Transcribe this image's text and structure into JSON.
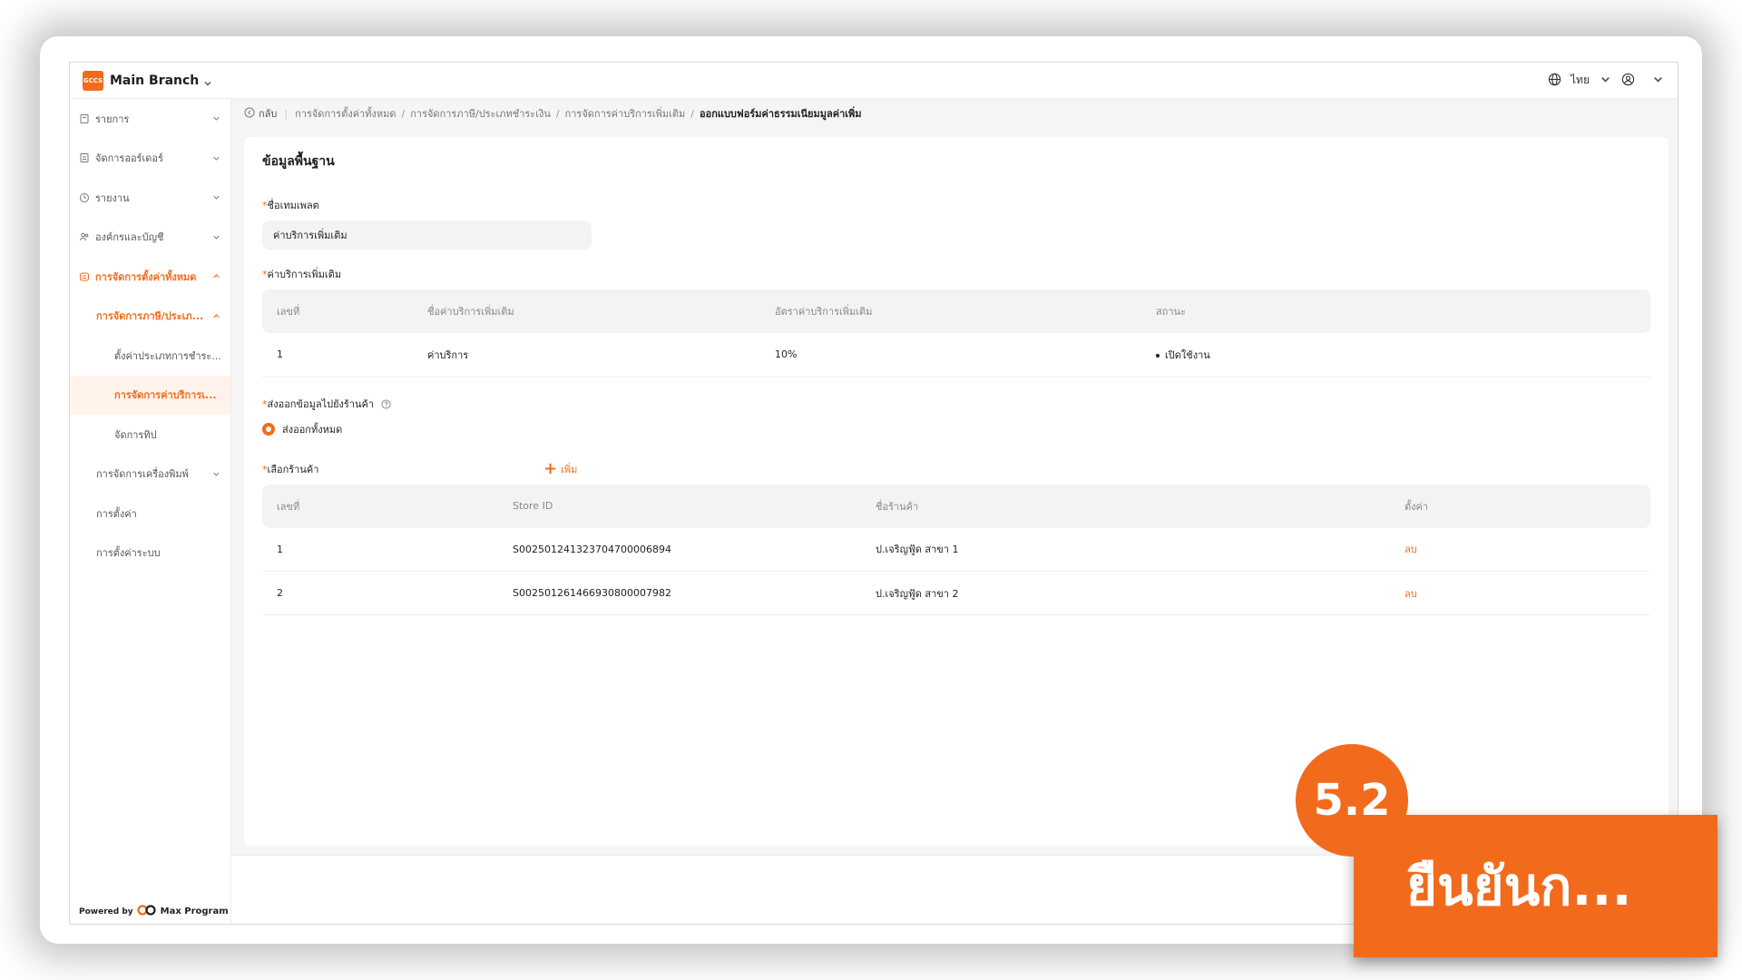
{
  "topbar": {
    "logo_text": "GCCS",
    "branch": "Main Branch",
    "language": "ไทย"
  },
  "sidebar": {
    "items": [
      {
        "label": "รายการ"
      },
      {
        "label": "จัดการออร์เดอร์"
      },
      {
        "label": "รายงาน"
      },
      {
        "label": "องค์กรและบัญชี"
      },
      {
        "label": "การจัดการตั้งค่าทั้งหมด"
      },
      {
        "label": "การจัดการภาษี/ประเภ..."
      },
      {
        "label": "ตั้งค่าประเภทการชำระ..."
      },
      {
        "label": "การจัดการค่าบริการเ..."
      },
      {
        "label": "จัดการทิป"
      },
      {
        "label": "การจัดการเครื่องพิมพ์"
      },
      {
        "label": "การตั้งค่า"
      },
      {
        "label": "การตั้งค่าระบบ"
      }
    ],
    "powered_by": "Powered by",
    "brand": "Max Program"
  },
  "breadcrumb": {
    "back": "กลับ",
    "items": [
      "การจัดการตั้งค่าทั้งหมด",
      "การจัดการภาษี/ประเภทชำระเงิน",
      "การจัดการค่าบริการเพิ่มเติม",
      "ออกแบบฟอร์มค่าธรรมเนียมมูลค่าเพิ่ม"
    ]
  },
  "form": {
    "section_title": "ข้อมูลพื้นฐาน",
    "template_label": "ชื่อเทมเพลต",
    "template_value": "ค่าบริการเพิ่มเติม",
    "service_label": "ค่าบริการเพิ่มเติม",
    "service_table": {
      "headers": [
        "เลขที่",
        "ชื่อค่าบริการเพิ่มเติม",
        "อัตราค่าบริการเพิ่มเติม",
        "สถานะ"
      ],
      "rows": [
        {
          "no": "1",
          "name": "ค่าบริการ",
          "rate": "10%",
          "status": "เปิดใช้งาน"
        }
      ]
    },
    "export_label": "ส่งออกข้อมูลไปยังร้านค้า",
    "export_option": "ส่งออกทั้งหมด",
    "store_label": "เลือกร้านค้า",
    "add_label": "เพิ่ม",
    "store_table": {
      "headers": [
        "เลขที่",
        "Store ID",
        "ชื่อร้านค้า",
        "ตั้งค่า"
      ],
      "rows": [
        {
          "no": "1",
          "store_id": "S002501241323704700006894",
          "name": "ป.เจริญฟู้ด สาขา 1",
          "action": "ลบ"
        },
        {
          "no": "2",
          "store_id": "S002501261466930800007982",
          "name": "ป.เจริญฟู้ด สาขา 2",
          "action": "ลบ"
        }
      ]
    }
  },
  "overlay": {
    "step": "5.2",
    "caption": "ยืนยันก..."
  },
  "colors": {
    "accent": "#f26b1d"
  }
}
